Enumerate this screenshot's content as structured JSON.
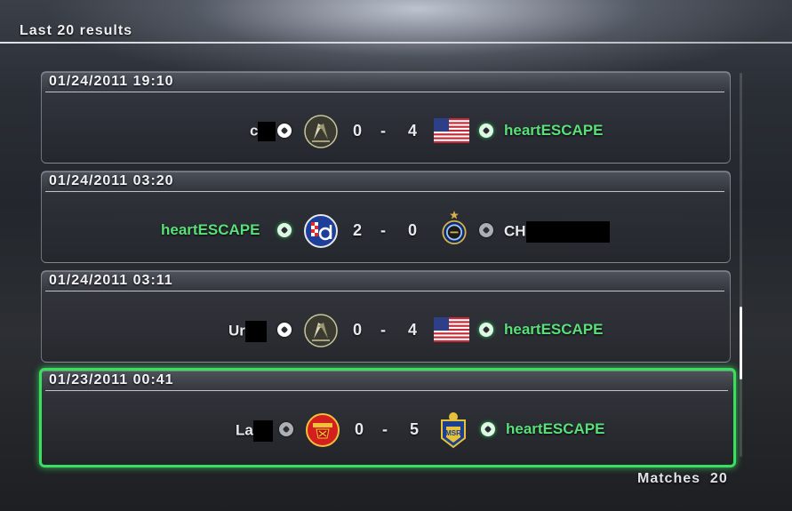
{
  "screen": {
    "title": "Last 20 results"
  },
  "footer": {
    "matches_label": "Matches",
    "matches_count": "20"
  },
  "colors": {
    "winner": "#59e07a",
    "selected_border": "#37e05d"
  },
  "results": [
    {
      "date": "01/24/2011 19:10",
      "home": {
        "name": "c",
        "redacted": true,
        "badge": "flags-crest-icon",
        "status": "ball-icon"
      },
      "home_score": "0",
      "separator": "-",
      "away_score": "4",
      "away": {
        "name": "heartESCAPE",
        "badge": "usa-flag-icon",
        "status": "ball-icon",
        "winner": true
      },
      "selected": false
    },
    {
      "date": "01/24/2011 03:20",
      "home": {
        "name": "heartESCAPE",
        "badge": "dinamo-zagreb-crest-icon",
        "status": "ball-icon",
        "winner": true
      },
      "home_score": "2",
      "separator": "-",
      "away_score": "0",
      "away": {
        "name": "CH",
        "redacted": true,
        "badge": "inter-crest-icon",
        "status": "ball-icon"
      },
      "selected": false
    },
    {
      "date": "01/24/2011 03:11",
      "home": {
        "name": "Ur",
        "redacted": true,
        "badge": "flags-crest-icon",
        "status": "ball-icon"
      },
      "home_score": "0",
      "separator": "-",
      "away_score": "4",
      "away": {
        "name": "heartESCAPE",
        "badge": "usa-flag-icon",
        "status": "ball-icon",
        "winner": true
      },
      "selected": false
    },
    {
      "date": "01/23/2011 00:41",
      "home": {
        "name": "La",
        "redacted": true,
        "badge": "manchester-united-crest-icon",
        "status": "ball-icon"
      },
      "home_score": "0",
      "separator": "-",
      "away_score": "5",
      "away": {
        "name": "heartESCAPE",
        "badge": "msr-crest-icon",
        "status": "ball-icon",
        "winner": true
      },
      "selected": true
    }
  ]
}
